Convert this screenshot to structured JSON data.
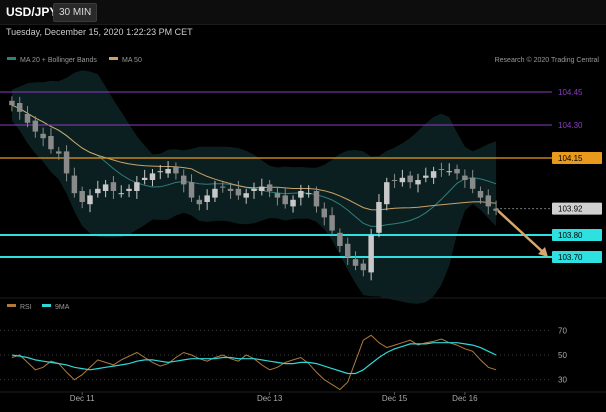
{
  "header": {
    "symbol": "USD/JPY",
    "interval": "30 MIN",
    "datetime": "Tuesday, December 15, 2020 1:22:23 PM CET"
  },
  "legend": {
    "ma20_label": "MA 20 + Bollinger Bands",
    "ma50_label": "MA 50",
    "credit": "Research © 2020 Trading Central",
    "rsi_label": "RSI",
    "rsi_ma_label": "9MA"
  },
  "colors": {
    "background": "#000000",
    "up_candle": "#c8c8c8",
    "down_candle": "#8a8a8a",
    "bollinger_fill": "#0d2426",
    "ma20": "#2f7f7a",
    "ma50": "#c9a36a",
    "resistance_purple": "#8a3dbf",
    "resistance_orange": "#e89a1c",
    "support_cyan": "#2fe0e0",
    "forecast_arrow": "#d8a86a",
    "rsi_line": "#b07a3e",
    "rsi_ma": "#2fd7d7"
  },
  "chart_data": [
    {
      "type": "candlestick",
      "ylim": [
        103.55,
        104.55
      ],
      "x": [
        "Dec 11",
        "Dec 13",
        "Dec 15",
        "Dec 16"
      ],
      "levels": [
        {
          "value": 104.45,
          "label": "104.45",
          "kind": "resistance-minor",
          "color": "#8a3dbf"
        },
        {
          "value": 104.3,
          "label": "104.30",
          "kind": "resistance-minor",
          "color": "#8a3dbf"
        },
        {
          "value": 104.15,
          "label": "104.15",
          "kind": "resistance",
          "color": "#e89a1c"
        },
        {
          "value": 103.92,
          "label": "103.92",
          "kind": "last-price",
          "color": "#d0d0d0"
        },
        {
          "value": 103.8,
          "label": "103.80",
          "kind": "support",
          "color": "#2fe0e0"
        },
        {
          "value": 103.7,
          "label": "103.70",
          "kind": "support",
          "color": "#2fe0e0"
        }
      ],
      "price_path": [
        104.39,
        104.36,
        104.31,
        104.27,
        104.24,
        104.19,
        104.17,
        104.08,
        103.99,
        103.95,
        103.98,
        104.01,
        104.03,
        104.0,
        103.99,
        104.01,
        104.04,
        104.06,
        104.08,
        104.09,
        104.1,
        104.08,
        104.03,
        103.97,
        103.94,
        103.98,
        104.01,
        104.02,
        104.0,
        103.98,
        103.99,
        104.01,
        104.02,
        104.0,
        103.97,
        103.94,
        103.96,
        104.0,
        103.99,
        103.93,
        103.88,
        103.82,
        103.75,
        103.7,
        103.66,
        103.64,
        103.8,
        103.95,
        104.04,
        104.05,
        104.06,
        104.04,
        104.05,
        104.07,
        104.09,
        104.1,
        104.09,
        104.08,
        104.05,
        104.01,
        103.97,
        103.93,
        103.91
      ],
      "forecast": {
        "from": 103.91,
        "to": 103.7,
        "direction": "down"
      },
      "indicators": [
        "MA 20",
        "Bollinger Bands",
        "MA 50"
      ]
    },
    {
      "type": "line",
      "ylim": [
        20,
        80
      ],
      "ticks": [
        70,
        50,
        30
      ],
      "series": [
        {
          "name": "RSI",
          "values": [
            48,
            50,
            44,
            38,
            40,
            45,
            43,
            36,
            30,
            34,
            40,
            46,
            44,
            42,
            46,
            49,
            52,
            48,
            44,
            41,
            43,
            48,
            52,
            50,
            47,
            45,
            48,
            50,
            47,
            45,
            50,
            47,
            42,
            38,
            40,
            44,
            46,
            48,
            43,
            36,
            30,
            26,
            22,
            28,
            45,
            62,
            66,
            60,
            56,
            58,
            60,
            62,
            58,
            60,
            61,
            63,
            60,
            58,
            55,
            53,
            46,
            40,
            38
          ]
        },
        {
          "name": "9MA",
          "values": [
            50,
            49,
            48,
            46,
            45,
            44,
            43,
            42,
            40,
            39,
            38,
            39,
            40,
            41,
            42,
            43,
            45,
            46,
            46,
            45,
            44,
            45,
            46,
            47,
            47,
            47,
            47,
            48,
            48,
            47,
            47,
            47,
            46,
            45,
            44,
            43,
            43,
            44,
            44,
            43,
            41,
            39,
            37,
            35,
            35,
            38,
            43,
            48,
            52,
            55,
            57,
            59,
            59,
            59,
            60,
            60,
            60,
            60,
            59,
            58,
            56,
            53,
            50
          ]
        }
      ]
    }
  ],
  "time_axis": [
    "Dec 11",
    "Dec 13",
    "Dec 15",
    "Dec 16"
  ]
}
